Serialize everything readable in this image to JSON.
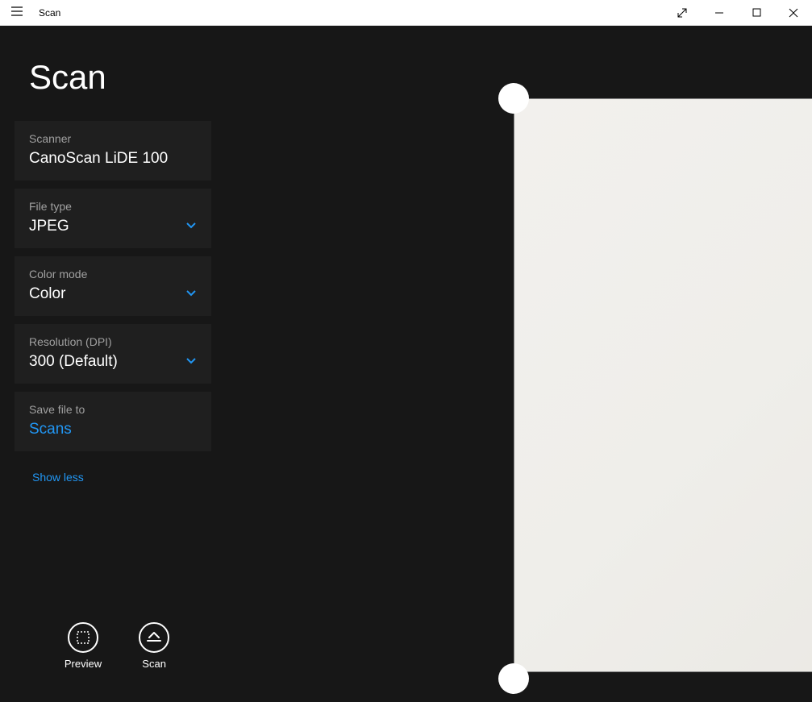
{
  "window": {
    "title": "Scan"
  },
  "page_title": "Scan",
  "options": {
    "scanner": {
      "label": "Scanner",
      "value": "CanoScan LiDE 100"
    },
    "file_type": {
      "label": "File type",
      "value": "JPEG"
    },
    "color_mode": {
      "label": "Color mode",
      "value": "Color"
    },
    "resolution": {
      "label": "Resolution (DPI)",
      "value": "300 (Default)"
    },
    "save_to": {
      "label": "Save file to",
      "value": "Scans"
    }
  },
  "toggle_link": "Show less",
  "actions": {
    "preview": "Preview",
    "scan": "Scan"
  }
}
